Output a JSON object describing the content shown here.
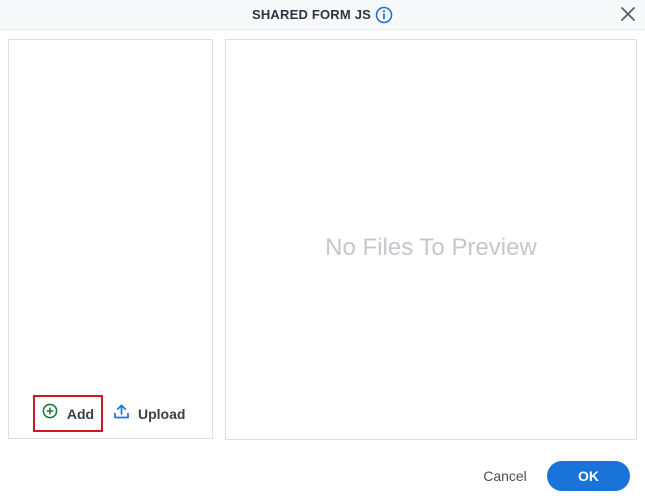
{
  "dialog": {
    "title": "SHARED FORM JS"
  },
  "file_list": {
    "add_label": "Add",
    "upload_label": "Upload"
  },
  "preview": {
    "empty_message": "No Files To Preview"
  },
  "footer": {
    "cancel_label": "Cancel",
    "ok_label": "OK"
  },
  "colors": {
    "accent": "#1a73d9",
    "add_icon": "#1e7a3c",
    "highlight_border": "#d0191f"
  },
  "icons": [
    "info-icon",
    "close-icon",
    "add-circle-icon",
    "upload-icon"
  ]
}
